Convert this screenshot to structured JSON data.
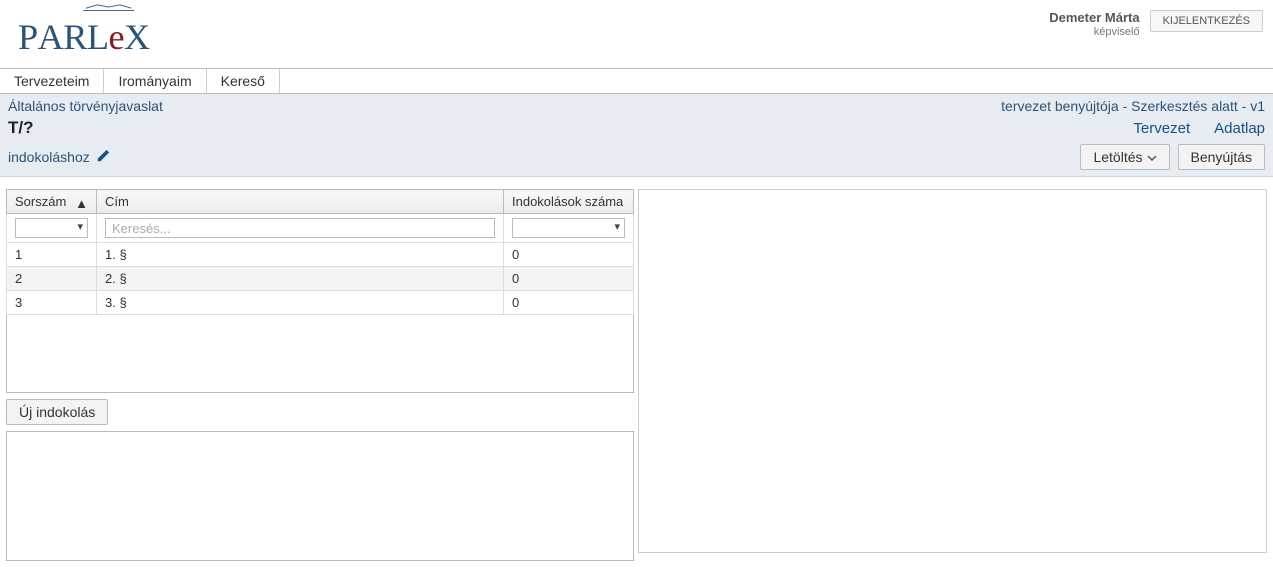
{
  "header": {
    "user_name": "Demeter Márta",
    "user_role": "képviselő",
    "logout_label": "KIJELENTKEZÉS"
  },
  "nav": {
    "items": [
      "Tervezeteim",
      "Irományaim",
      "Kereső"
    ]
  },
  "titlebar": {
    "doc_type": "Általános törvényjavaslat",
    "status_prefix": "tervezet benyújtója",
    "status_state": "Szerkesztés alatt",
    "version": "v1",
    "doc_id": "T/?",
    "link_tervezet": "Tervezet",
    "link_adatlap": "Adatlap",
    "indokolashoz": "indokoláshoz",
    "download_label": "Letöltés",
    "submit_label": "Benyújtás"
  },
  "table": {
    "headers": {
      "sorszam": "Sorszám",
      "cim": "Cím",
      "indok_count": "Indokolások száma"
    },
    "search_placeholder": "Keresés...",
    "rows": [
      {
        "sorszam": "1",
        "cim": "1. §",
        "count": "0"
      },
      {
        "sorszam": "2",
        "cim": "2. §",
        "count": "0"
      },
      {
        "sorszam": "3",
        "cim": "3. §",
        "count": "0"
      }
    ]
  },
  "buttons": {
    "new_indokolas": "Új indokolás"
  }
}
